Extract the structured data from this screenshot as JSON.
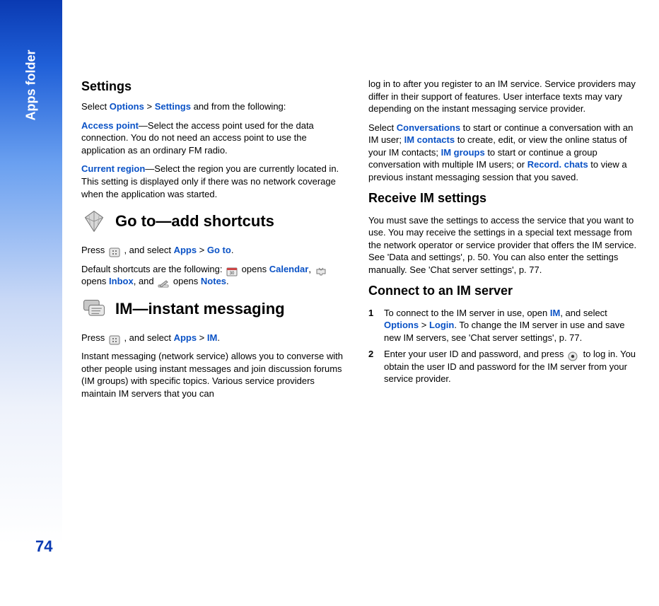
{
  "side_label": "Apps folder",
  "page_number": "74",
  "col1": {
    "settings_heading": "Settings",
    "settings_para_pre": "Select ",
    "settings_options": "Options",
    "settings_gt": " > ",
    "settings_settings": "Settings",
    "settings_para_post": " and from the following:",
    "access_point_label": "Access point",
    "access_point_text": "—Select the access point used for the data connection. You do not need an access point to use the application as an ordinary FM radio.",
    "current_region_label": "Current region",
    "current_region_text": "—Select the region you are currently located in. This setting is displayed only if there was no network coverage when the application was started.",
    "goto_heading": "Go to—add shortcuts",
    "goto_press_pre": "Press ",
    "goto_press_mid": " , and select ",
    "goto_apps": "Apps",
    "goto_gt": " > ",
    "goto_goto": "Go to",
    "goto_press_post": ".",
    "shortcuts_pre": "Default shortcuts are the following: ",
    "shortcuts_opens1": " opens ",
    "shortcuts_calendar": "Calendar",
    "shortcuts_mid": ", ",
    "shortcuts_opens2": " opens ",
    "shortcuts_inbox": "Inbox",
    "shortcuts_and": ", and ",
    "shortcuts_opens3": " opens ",
    "shortcuts_notes": "Notes",
    "shortcuts_post": ".",
    "im_heading": "IM—instant messaging",
    "im_press_pre": "Press ",
    "im_press_mid": " , and select ",
    "im_apps": "Apps",
    "im_gt": " > ",
    "im_im": "IM",
    "im_press_post": ".",
    "im_para": "Instant messaging (network service) allows you to converse with other people using instant messages and join discussion forums (IM groups) with specific topics. Various service providers maintain IM servers that you can"
  },
  "col2": {
    "continue_para": "log in to after you register to an IM service. Service providers may differ in their support of features. User interface texts may vary depending on the instant messaging service provider.",
    "select_pre": "Select ",
    "conversations": "Conversations",
    "select_mid1": " to start or continue a conversation with an IM user; ",
    "im_contacts": "IM contacts",
    "select_mid2": " to create, edit, or view the online status of your IM contacts; ",
    "im_groups": "IM groups",
    "select_mid3": " to start or continue a group conversation with multiple IM users; or ",
    "record_chats": "Record. chats",
    "select_post": " to view a previous instant messaging session that you saved.",
    "receive_heading": "Receive IM settings",
    "receive_para": "You must save the settings to access the service that you want to use. You may receive the settings in a special text message from the network operator or service provider that offers the IM service. See 'Data and settings', p. 50. You can also enter the settings manually. See 'Chat server settings', p. 77.",
    "connect_heading": "Connect to an IM server",
    "step1_num": "1",
    "step1_pre": "To connect to the IM server in use, open ",
    "step1_im": "IM",
    "step1_mid1": ", and select ",
    "step1_options": "Options",
    "step1_gt": " > ",
    "step1_login": "Login",
    "step1_post": ". To change the IM server in use and save new IM servers, see 'Chat server settings', p. 77.",
    "step2_num": "2",
    "step2_pre": "Enter your user ID and password, and press ",
    "step2_post": " to log in. You obtain the user ID and password for the IM server from your service provider."
  }
}
